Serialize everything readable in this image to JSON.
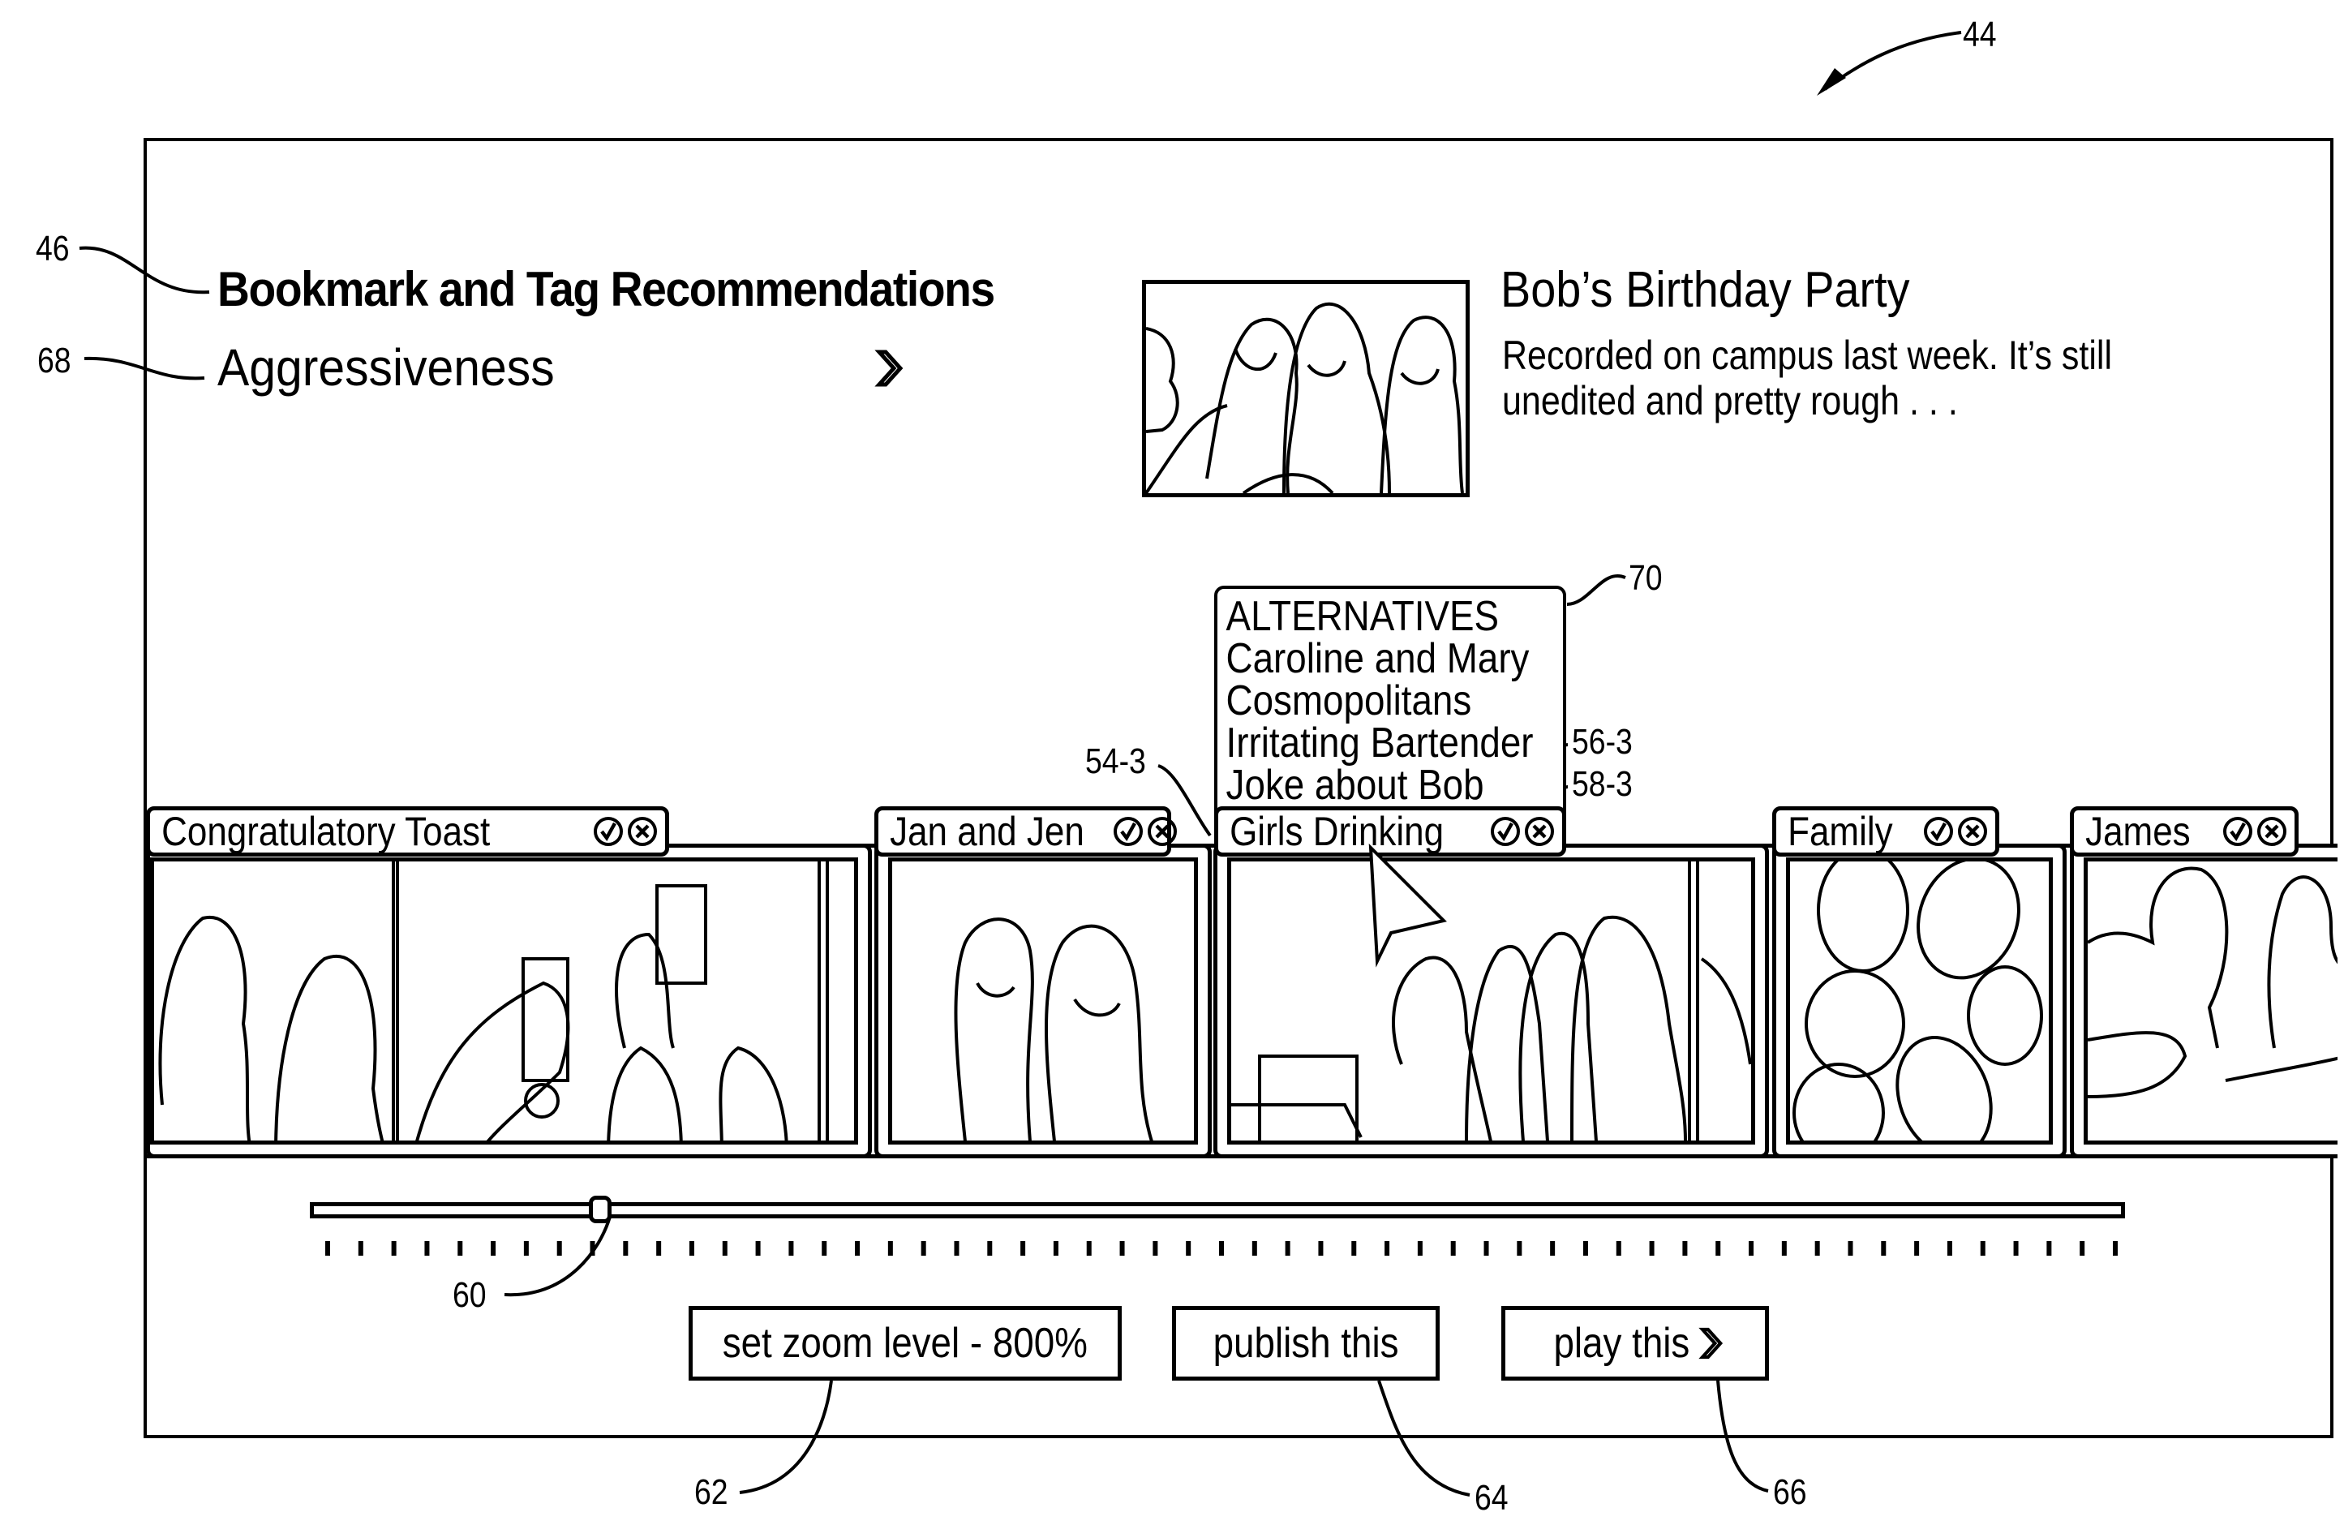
{
  "figure_ref": "44",
  "header": {
    "title": "Bookmark and Tag Recommendations",
    "aggressiveness_label": "Aggressiveness",
    "aggressiveness_icon": "double-chevron-right-icon"
  },
  "video": {
    "title": "Bob’s Birthday Party",
    "description": "Recorded on campus last week.  It’s still unedited and pretty rough . . ."
  },
  "alternatives": {
    "heading": "ALTERNATIVES",
    "items": [
      "Caroline and Mary",
      "Cosmopolitans",
      "Irritating Bartender",
      "Joke about Bob"
    ]
  },
  "clips": [
    {
      "tag": "Congratulatory Toast",
      "accept_icon": "check-circle-icon",
      "reject_icon": "x-circle-icon"
    },
    {
      "tag": "Jan and Jen",
      "accept_icon": "check-circle-icon",
      "reject_icon": "x-circle-icon"
    },
    {
      "tag": "Girls Drinking",
      "accept_icon": "check-circle-icon",
      "reject_icon": "x-circle-icon"
    },
    {
      "tag": "Family",
      "accept_icon": "check-circle-icon",
      "reject_icon": "x-circle-icon"
    },
    {
      "tag": "James",
      "accept_icon": "check-circle-icon",
      "reject_icon": "x-circle-icon"
    }
  ],
  "timeline": {
    "slider_position_fraction": 0.16
  },
  "buttons": {
    "zoom": "set zoom level - 800%",
    "publish": "publish this",
    "play": "play this"
  },
  "reference_numerals": {
    "r44": "44",
    "r46": "46",
    "r68": "68",
    "r70": "70",
    "r54_3": "54-3",
    "r56_3": "56-3",
    "r58_3": "58-3",
    "r60": "60",
    "r62": "62",
    "r64": "64",
    "r66": "66"
  }
}
